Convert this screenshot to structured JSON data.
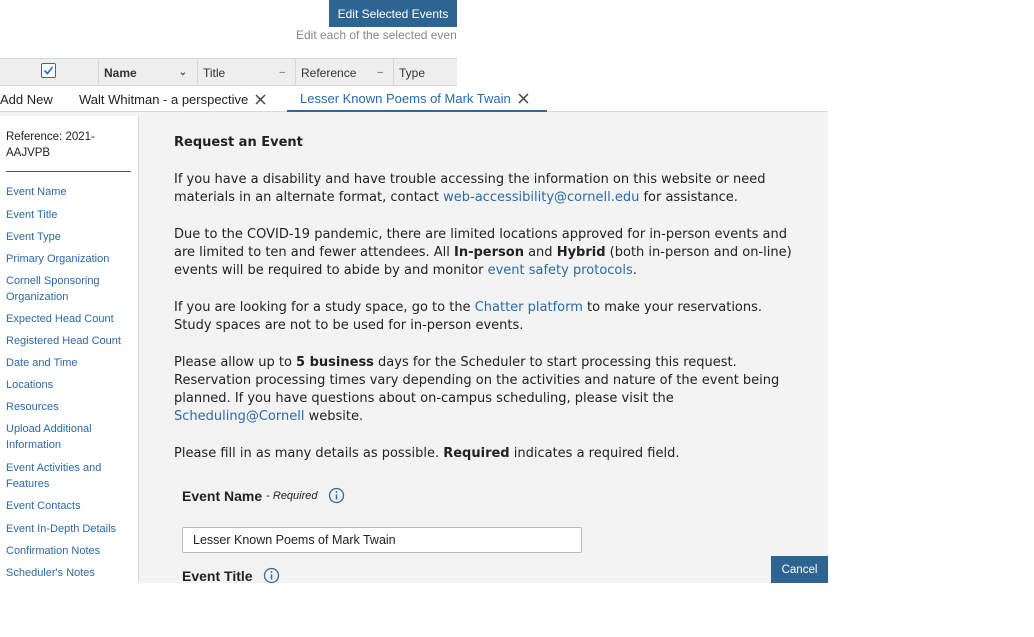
{
  "background": {
    "toolbar_button": "Edit Selected Events",
    "hint": "Edit each of the selected events",
    "columns": [
      "Name",
      "Title",
      "Reference",
      "Type"
    ]
  },
  "tabs": {
    "add_new": "Add New",
    "items": [
      "Walt Whitman - a perspective",
      "Lesser Known Poems of Mark Twain"
    ]
  },
  "sidebar": {
    "reference": "Reference: 2021-AAJVPB",
    "items": [
      "Event Name",
      "Event Title",
      "Event Type",
      "Primary Organization",
      "Cornell Sponsoring Organization",
      "Expected Head Count",
      "Registered Head Count",
      "Date and Time",
      "Locations",
      "Resources",
      "Upload Additional Information",
      "Event Activities and Features",
      "Event Contacts",
      "Event In-Depth Details",
      "Confirmation Notes",
      "Scheduler's Notes"
    ]
  },
  "content": {
    "heading": "Request an Event",
    "p1_a": "If you have a disability and have trouble accessing the information on this website or need materials in an alternate format, contact ",
    "p1_link": "web-accessibility@cornell.edu",
    "p1_b": " for assistance.",
    "p2_a": "Due to the COVID-19 pandemic, there are limited locations approved for in-person events and are limited to ten and fewer attendees. All ",
    "p2_bold1": "In-person",
    "p2_b": " and ",
    "p2_bold2": "Hybrid",
    "p2_c": " (both in-person and on-line) events will be required to abide by and monitor ",
    "p2_link": "event safety protocols",
    "p2_d": ".",
    "p3_a": "If you are looking for a study space, go to the ",
    "p3_link": "Chatter platform",
    "p3_b": " to make your reservations. Study spaces are not to be used for in-person events.",
    "p4_a": "Please allow up to ",
    "p4_bold": "5 business",
    "p4_b": " days for the Scheduler to start processing this request. Reservation processing times vary depending on the activities and nature of the event being planned. If you have questions about on-campus scheduling, please visit the ",
    "p4_link": "Scheduling@Cornell",
    "p4_c": " website.",
    "p5_a": "Please fill in as many details as possible. ",
    "p5_bold": "Required",
    "p5_b": " indicates a required field."
  },
  "form": {
    "event_name_label": "Event Name",
    "required_text": "- Required",
    "event_name_value": "Lesser Known Poems of Mark Twain",
    "event_title_label": "Event Title"
  },
  "actions": {
    "cancel": "Cancel"
  }
}
